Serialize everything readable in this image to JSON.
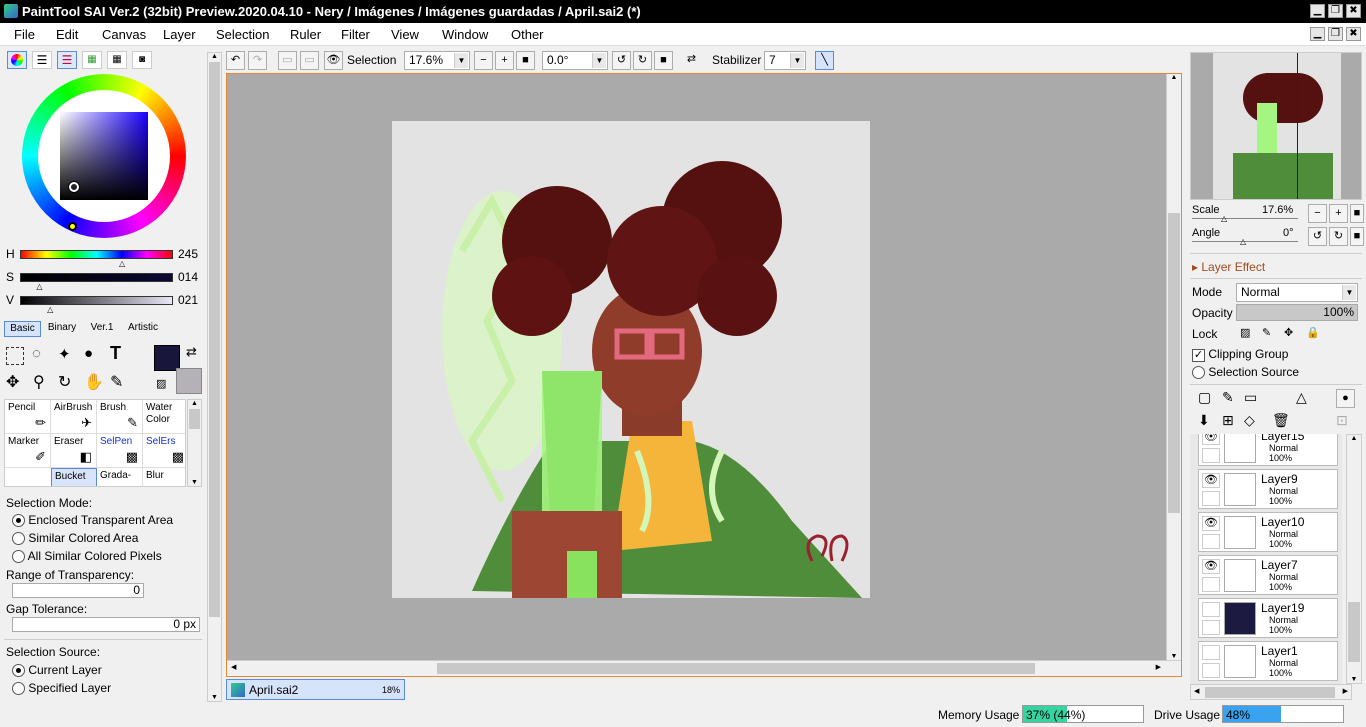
{
  "window": {
    "title": "PaintTool SAI Ver.2 (32bit) Preview.2020.04.10 - Nery / Imágenes / Imágenes guardadas / April.sai2 (*)",
    "min": "▁",
    "restore": "❐",
    "close": "✖"
  },
  "menu": [
    "File",
    "Edit",
    "Canvas",
    "Layer",
    "Selection",
    "Ruler",
    "Filter",
    "View",
    "Window",
    "Other"
  ],
  "toolbar": {
    "selection_label": "Selection",
    "zoom": "17.6%",
    "rotation": "0.0°",
    "stabilizer_label": "Stabilizer",
    "stabilizer_value": "7"
  },
  "color": {
    "h_label": "H",
    "h_value": "245",
    "s_label": "S",
    "s_value": "014",
    "v_label": "V",
    "v_value": "021",
    "h_level": 0.68,
    "s_level": 0.14,
    "v_level": 0.21,
    "primary": "#18163a",
    "secondary": "#b5b2b7"
  },
  "tool_tabs": [
    "Basic",
    "Binary",
    "Ver.1",
    "Artistic"
  ],
  "tools": [
    {
      "name": "Pencil",
      "label": "Pencil"
    },
    {
      "name": "AirBrush",
      "label": "AirBrush"
    },
    {
      "name": "Brush",
      "label": "Brush"
    },
    {
      "name": "Water",
      "label": "Water\nColor"
    },
    {
      "name": "Marker",
      "label": "Marker"
    },
    {
      "name": "Eraser",
      "label": "Eraser"
    },
    {
      "name": "SelPen",
      "label": "SelPen"
    },
    {
      "name": "SelErs",
      "label": "SelErs"
    },
    {
      "name": "Bucket",
      "label": "Bucket"
    },
    {
      "name": "Grada",
      "label": "Grada-"
    },
    {
      "name": "Blur",
      "label": "Blur"
    }
  ],
  "options": {
    "selection_mode_label": "Selection Mode:",
    "modes": [
      "Enclosed Transparent Area",
      "Similar Colored Area",
      "All Similar Colored Pixels"
    ],
    "range_label": "Range of Transparency:",
    "range_value": "0",
    "gap_label": "Gap Tolerance:",
    "gap_value": "0 px",
    "source_label": "Selection Source:",
    "sources": [
      "Current Layer",
      "Specified Layer"
    ]
  },
  "navigator": {
    "scale_label": "Scale",
    "scale_value": "17.6%",
    "angle_label": "Angle",
    "angle_value": "0°"
  },
  "layer_effect": {
    "title": "Layer Effect",
    "mode_label": "Mode",
    "mode_value": "Normal",
    "opacity_label": "Opacity",
    "opacity_value": "100%",
    "lock_label": "Lock",
    "clipping": "Clipping Group",
    "source": "Selection Source"
  },
  "layers": [
    {
      "name": "Layer15",
      "mode": "Normal",
      "opacity": "100%",
      "visible": true,
      "thumb": "#fff"
    },
    {
      "name": "Layer9",
      "mode": "Normal",
      "opacity": "100%",
      "visible": true,
      "thumb": "#fff"
    },
    {
      "name": "Layer10",
      "mode": "Normal",
      "opacity": "100%",
      "visible": true,
      "thumb": "#fff"
    },
    {
      "name": "Layer7",
      "mode": "Normal",
      "opacity": "100%",
      "visible": true,
      "thumb": "#fff"
    },
    {
      "name": "Layer19",
      "mode": "Normal",
      "opacity": "100%",
      "visible": false,
      "thumb": "#1c1a40"
    },
    {
      "name": "Layer1",
      "mode": "Normal",
      "opacity": "100%",
      "visible": false,
      "thumb": "#fff"
    }
  ],
  "doc_tab": {
    "name": "April.sai2",
    "zoom": "18%"
  },
  "status": {
    "memory_label": "Memory Usage",
    "memory_value": "37% (44%)",
    "memory_level": 0.37,
    "drive_label": "Drive Usage",
    "drive_value": "48%",
    "drive_level": 0.48
  }
}
